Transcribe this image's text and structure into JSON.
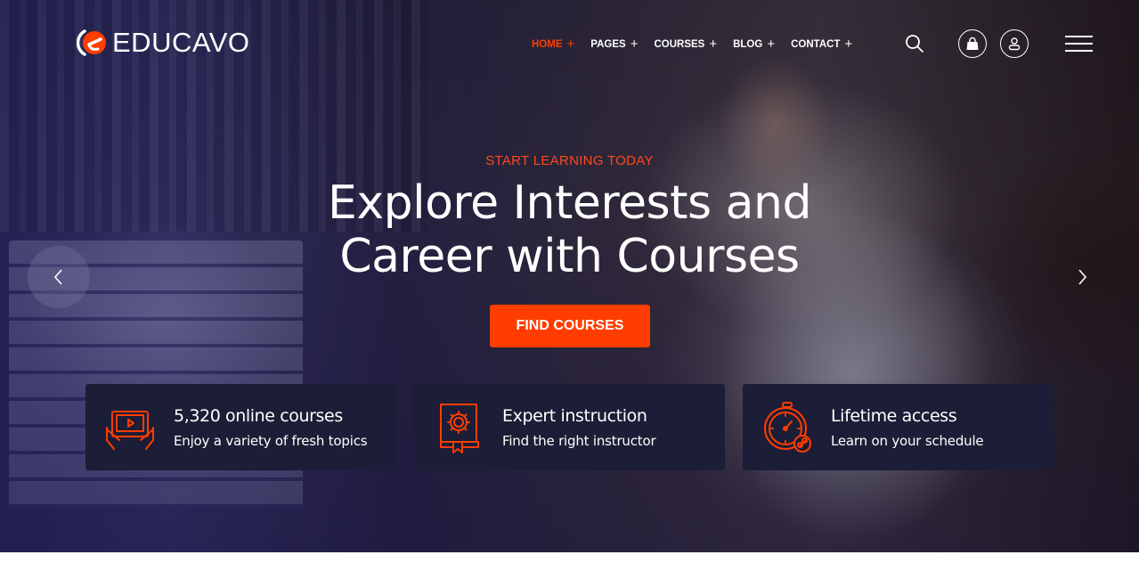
{
  "brand": {
    "name": "EDUCAVO",
    "accent": "#ff3d00",
    "panel": "#1c1d36"
  },
  "nav": {
    "items": [
      {
        "label": "HOME",
        "active": true
      },
      {
        "label": "PAGES",
        "active": false
      },
      {
        "label": "COURSES",
        "active": false
      },
      {
        "label": "BLOG",
        "active": false
      },
      {
        "label": "CONTACT",
        "active": false
      }
    ],
    "expand_glyph": "+"
  },
  "header_icons": [
    "search-icon",
    "shopping-bag-icon",
    "user-icon",
    "hamburger-menu-icon"
  ],
  "hero": {
    "eyebrow": "START LEARNING TODAY",
    "headline_line1": "Explore Interests and",
    "headline_line2": "Career with Courses",
    "cta_label": "FIND COURSES",
    "prev_icon": "chevron-left-icon",
    "next_icon": "chevron-right-icon"
  },
  "features": [
    {
      "icon": "tablet-video-icon",
      "title": "5,320 online courses",
      "subtitle": "Enjoy a variety of fresh topics"
    },
    {
      "icon": "book-gear-icon",
      "title": "Expert instruction",
      "subtitle": "Find the right instructor"
    },
    {
      "icon": "stopwatch-link-icon",
      "title": "Lifetime access",
      "subtitle": "Learn on your schedule"
    }
  ]
}
